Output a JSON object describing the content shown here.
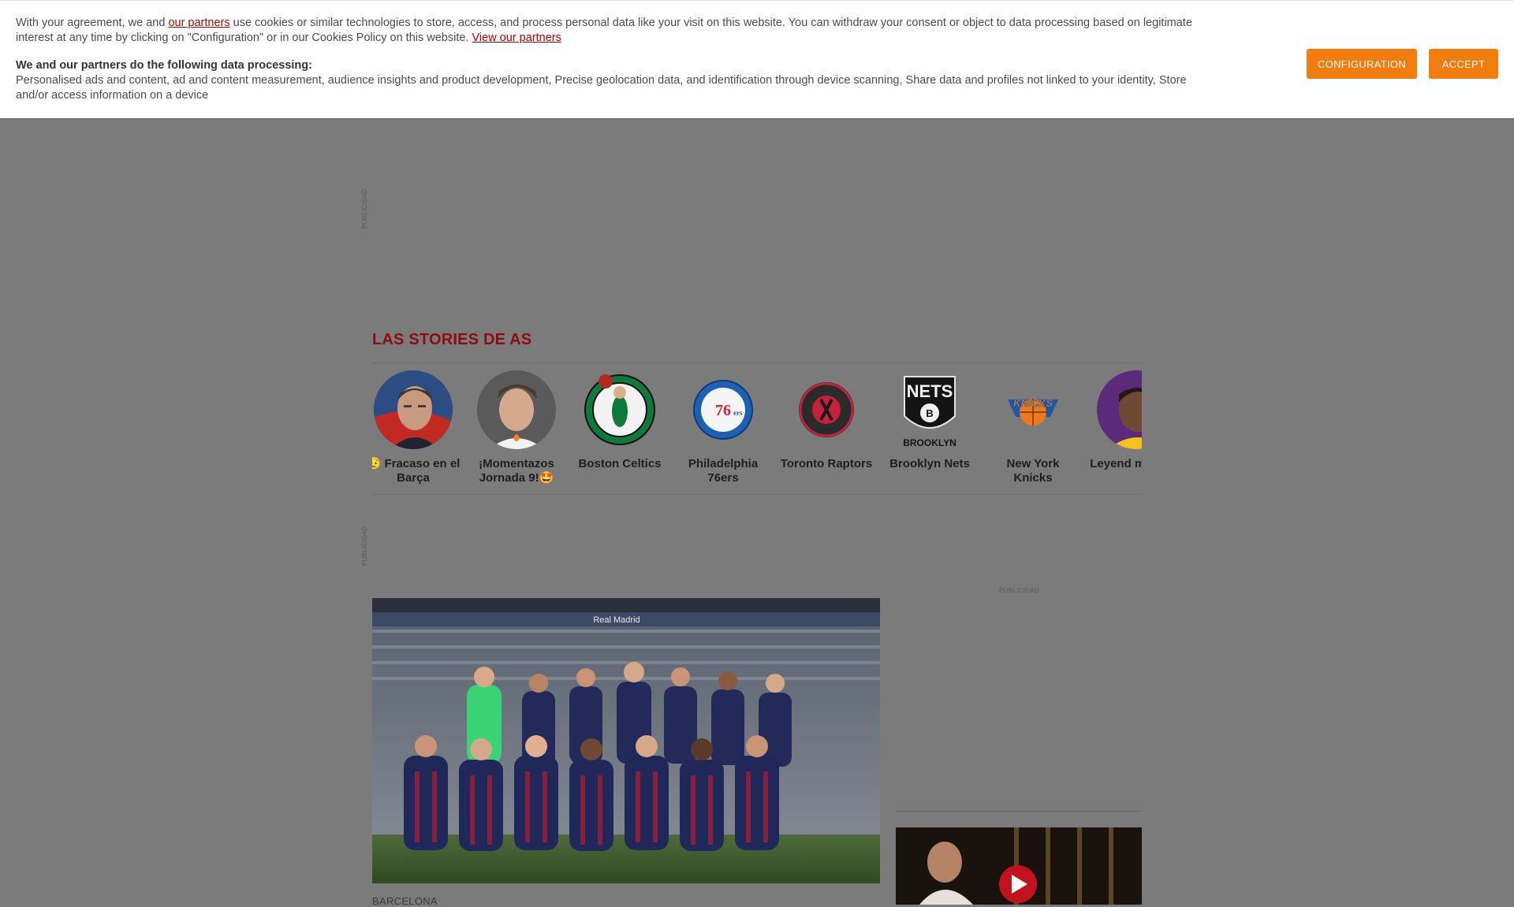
{
  "cookie_banner": {
    "intro_prefix": "With your agreement, we and ",
    "partners_link": "our partners",
    "intro_suffix": " use cookies or similar technologies to store, access, and process personal data like your visit on this website. You can withdraw your consent or object to data processing based on legitimate interest at any time by clicking on \"Configuration\" or in our Cookies Policy on this website. ",
    "view_partners_link": "View our partners",
    "processing_title": "We and our partners do the following data processing:",
    "processing_text": "Personalised ads and content, ad and content measurement, audience insights and product development, Precise geolocation data, and identification through device scanning, Share data and profiles not linked to your identity, Store and/or access information on a device",
    "configuration_label": "CONFIGURATION",
    "accept_label": "ACCEPT",
    "accent_color": "#f17d0e"
  },
  "ads": {
    "label_top": "PUBLICIDAD",
    "label_middle": "PUBLICIDAD",
    "label_side": "PUBLICIDAD"
  },
  "stories": {
    "title": "LAS STORIES DE AS",
    "title_color": "#8c0d0d",
    "items": [
      {
        "label": "😥 Fracaso en el Barça",
        "image": "portrait-laporta"
      },
      {
        "label": "¡Momentazos Jornada 9!🤩",
        "image": "portrait-valverde"
      },
      {
        "label": "Boston Celtics",
        "image": "celtics-logo"
      },
      {
        "label": "Philadelphia 76ers",
        "image": "76ers-logo"
      },
      {
        "label": "Toronto Raptors",
        "image": "raptors-logo"
      },
      {
        "label": "Brooklyn Nets",
        "image": "nets-logo"
      },
      {
        "label": "New York Knicks",
        "image": "knicks-logo"
      },
      {
        "label": "Leyend mate a L",
        "image": "portrait-lebron"
      }
    ]
  },
  "main_article": {
    "image": "barcelona-team-photo",
    "stadium_sign": "Real Madrid",
    "category": "BARCELONA"
  },
  "side_video": {
    "image": "video-thumbnail",
    "icon": "play-icon"
  }
}
